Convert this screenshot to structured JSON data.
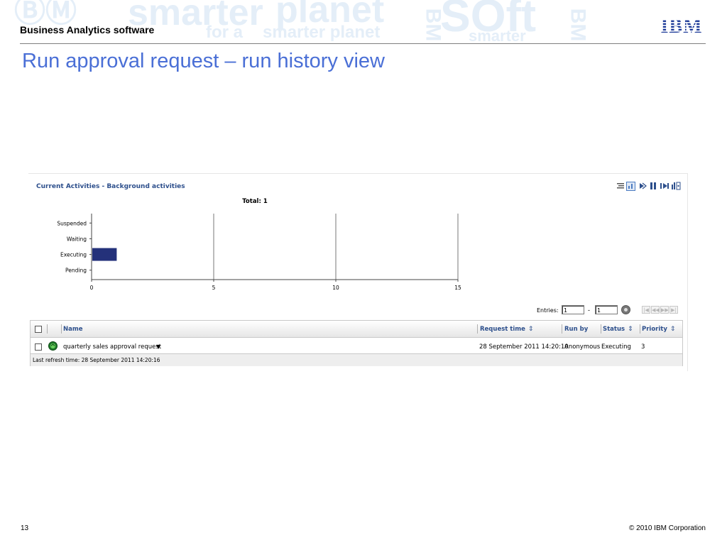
{
  "slide": {
    "app_title": "Business Analytics software",
    "title": "Run approval request – run history view",
    "page_number": "13",
    "copyright": "© 2010 IBM Corporation",
    "logo_text": "IBM",
    "watermark": [
      "smarter",
      "planet",
      "SOft",
      "for a",
      "smarter planet",
      "BM",
      "BM",
      "smarter"
    ]
  },
  "activities": {
    "title": "Current Activities - Background activities",
    "toolbar_icons": [
      "list-view-icon",
      "chart-view-icon",
      "run-icon",
      "suspend-icon",
      "release-icon",
      "priority-icon"
    ],
    "entries_label": "Entries:",
    "entries_from": "1",
    "entries_dash": "-",
    "entries_to": "1",
    "pager": [
      "|◀",
      "◀◀",
      "▶▶",
      "▶|"
    ]
  },
  "chart_data": {
    "type": "bar",
    "orientation": "horizontal",
    "title": "Total: 1",
    "categories": [
      "Suspended",
      "Waiting",
      "Executing",
      "Pending"
    ],
    "values": [
      0,
      0,
      1,
      0
    ],
    "xticks": [
      "0",
      "5",
      "10",
      "15"
    ],
    "xlim": [
      0,
      15
    ],
    "color": "#24317a",
    "grid": "vertical"
  },
  "table": {
    "columns": [
      "Name",
      "Request time",
      "Run by",
      "Status",
      "Priority"
    ],
    "rows": [
      {
        "name": "quarterly sales approval request",
        "request_time": "28 September 2011 14:20:10",
        "run_by": "Anonymous",
        "status": "Executing",
        "priority": "3"
      }
    ],
    "last_refresh": "Last refresh time: 28 September 2011 14:20:16"
  }
}
